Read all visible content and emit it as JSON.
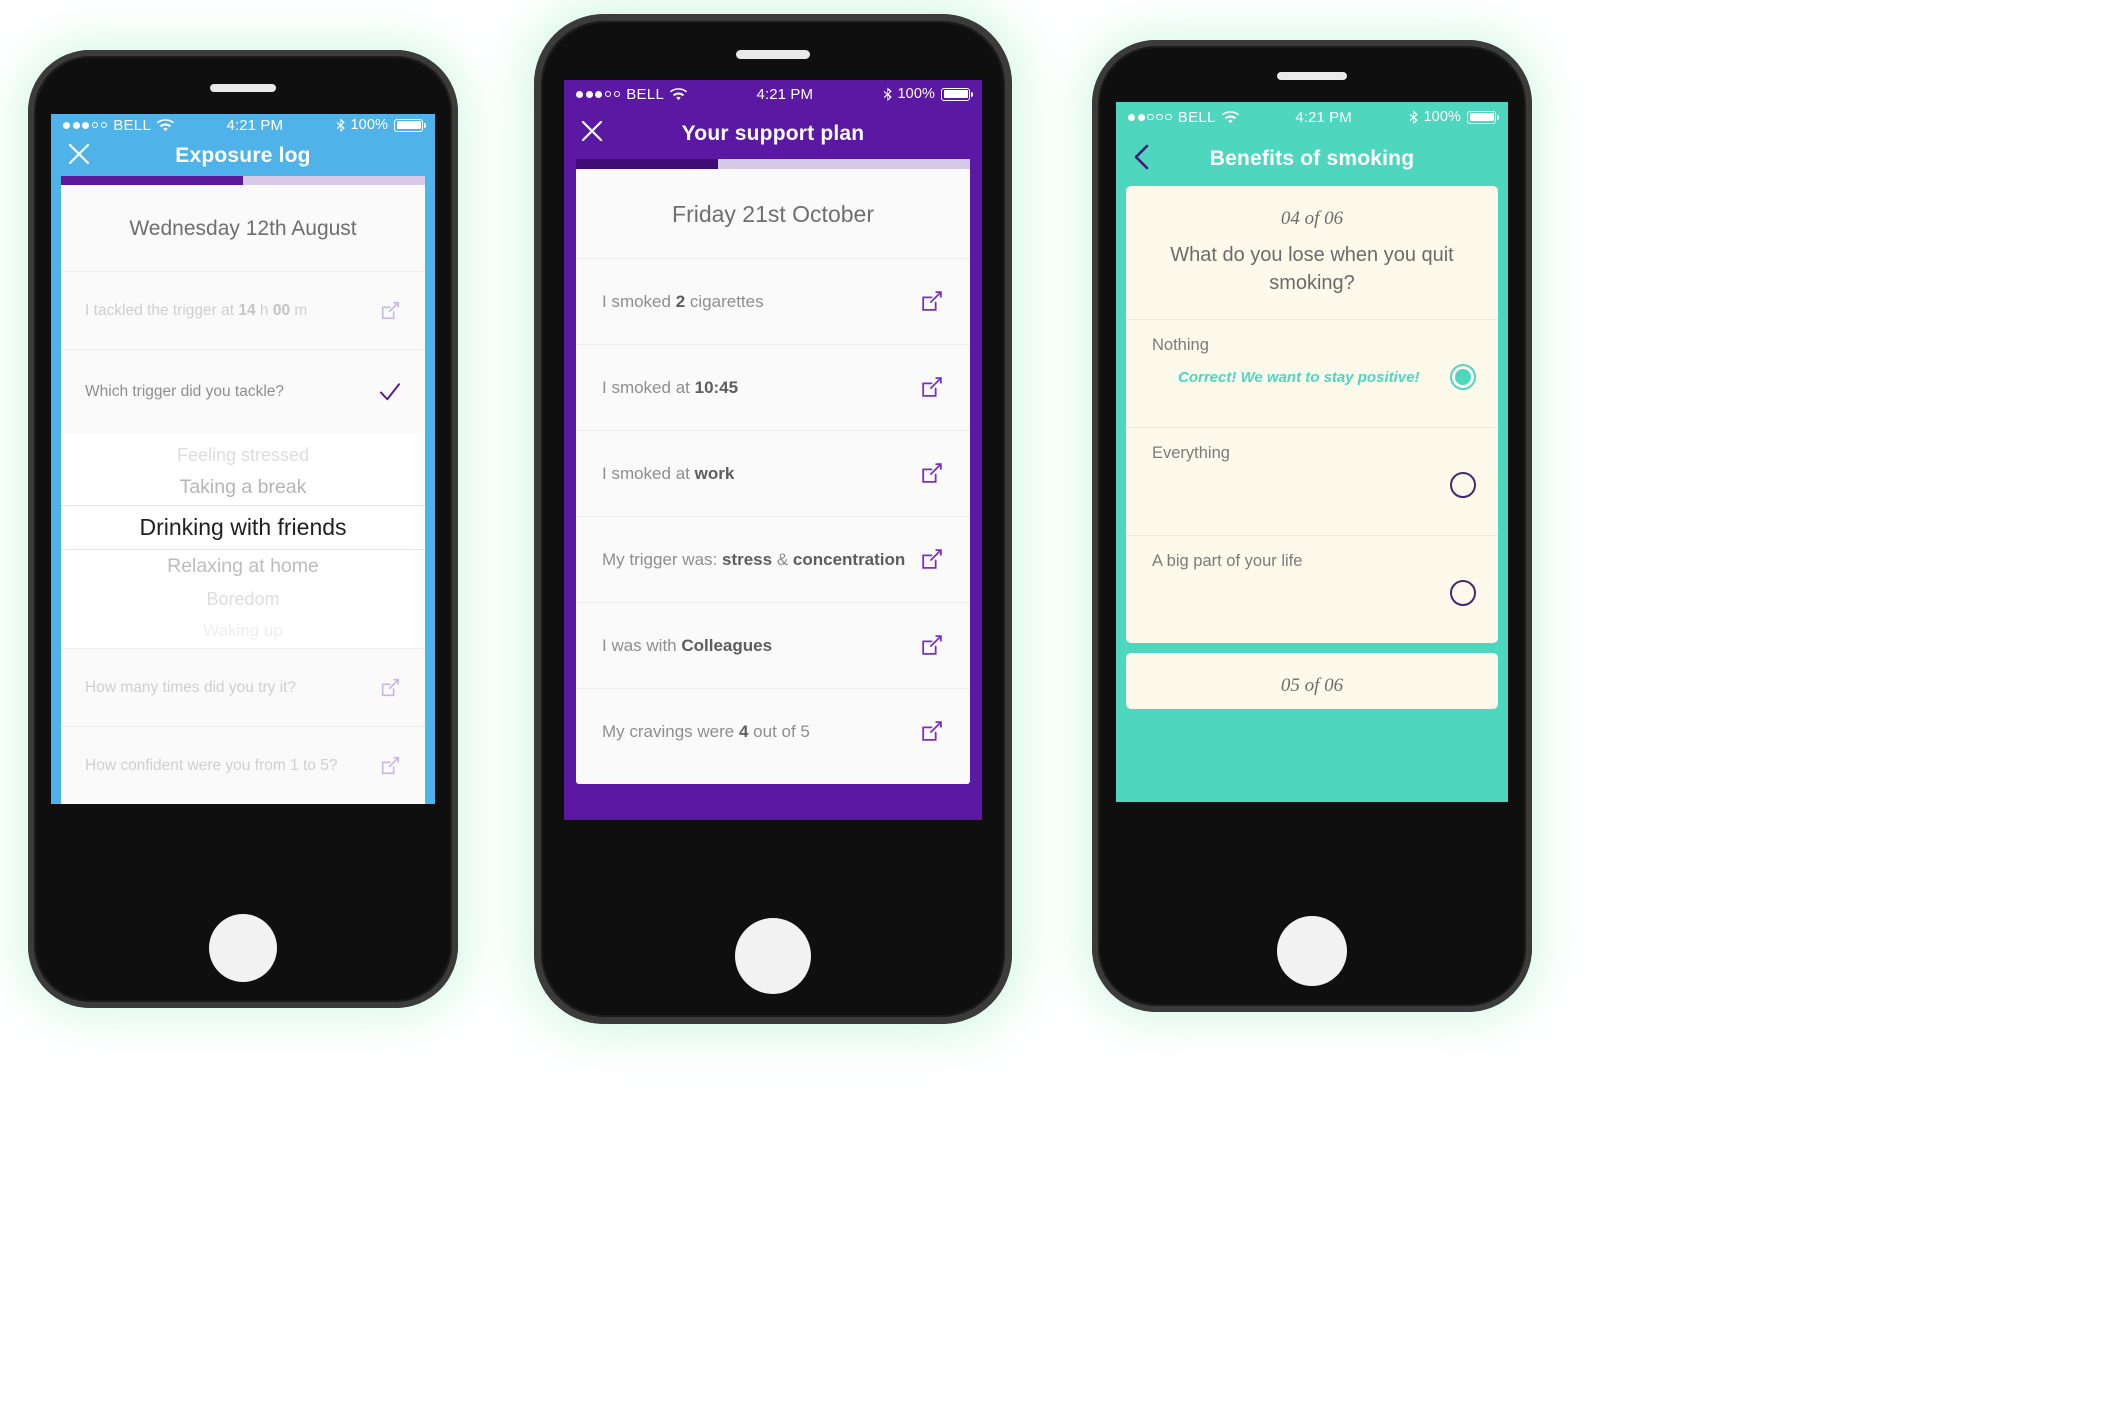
{
  "phone1": {
    "status": {
      "carrier": "BELL",
      "time": "4:21 PM",
      "battery": "100%",
      "signal_filled": 3,
      "signal_total": 5
    },
    "nav": {
      "title": "Exposure log",
      "close_icon": "close-icon"
    },
    "accent": "#4fb3ea",
    "progress": {
      "fill_percent": 50,
      "fill_color": "#5b189b",
      "rest_color": "#d9c9e8"
    },
    "date": "Wednesday 12th August",
    "rows": [
      {
        "text": "I tackled the trigger at 14 h 00 m",
        "icon": "edit-icon",
        "faded": true
      },
      {
        "text": "Which trigger did you tackle?",
        "icon": "check-icon",
        "faded": false
      }
    ],
    "wheel": {
      "items": [
        "Feeling stressed",
        "Taking a break",
        "Drinking with friends",
        "Relaxing at home",
        "Boredom",
        "Waking up"
      ],
      "selected": "Drinking with friends",
      "selected_index": 2
    },
    "bottom_rows": [
      {
        "text": "How many times did you try it?",
        "icon": "edit-icon"
      },
      {
        "text": "How confident were you from 1 to 5?",
        "icon": "edit-icon"
      }
    ]
  },
  "phone2": {
    "status": {
      "carrier": "BELL",
      "time": "4:21 PM",
      "battery": "100%",
      "signal_filled": 3,
      "signal_total": 5
    },
    "nav": {
      "title": "Your support plan",
      "close_icon": "close-icon"
    },
    "accent": "#5b18a3",
    "progress": {
      "fill_percent": 36,
      "fill_color": "#3f0d73",
      "rest_color": "#d6c9e8"
    },
    "date": "Friday 21st October",
    "rows": [
      {
        "pre": "I smoked ",
        "bold": "2",
        "post": " cigarettes",
        "icon": "edit-icon"
      },
      {
        "pre": "I smoked at ",
        "bold": "10:45",
        "post": "",
        "icon": "edit-icon"
      },
      {
        "pre": "I smoked at ",
        "bold": "work",
        "post": "",
        "icon": "edit-icon"
      },
      {
        "pre": "My trigger was: ",
        "bold": "stress",
        "mid": " & ",
        "bold2": "concentration",
        "post": "",
        "icon": "edit-icon"
      },
      {
        "pre": "I was with ",
        "bold": "Colleagues",
        "post": "",
        "icon": "edit-icon"
      },
      {
        "pre": "My cravings were ",
        "bold": "4",
        "post": " out of 5",
        "icon": "edit-icon"
      }
    ]
  },
  "phone3": {
    "status": {
      "carrier": "BELL",
      "time": "4:21 PM",
      "battery": "100%",
      "signal_filled": 2,
      "signal_total": 5
    },
    "nav": {
      "title": "Benefits of smoking",
      "back_icon": "chevron-left-icon"
    },
    "accent": "#4ed6bf",
    "card_bg": "#fdfaec",
    "question": {
      "number": "04 of 06",
      "text": "What do you lose when you quit smoking?",
      "options": [
        {
          "label": "Nothing",
          "selected": true,
          "feedback": "Correct! We want to stay positive!"
        },
        {
          "label": "Everything",
          "selected": false,
          "feedback": ""
        },
        {
          "label": "A big part of your life",
          "selected": false,
          "feedback": ""
        }
      ]
    },
    "next_question": {
      "number": "05 of 06"
    }
  }
}
